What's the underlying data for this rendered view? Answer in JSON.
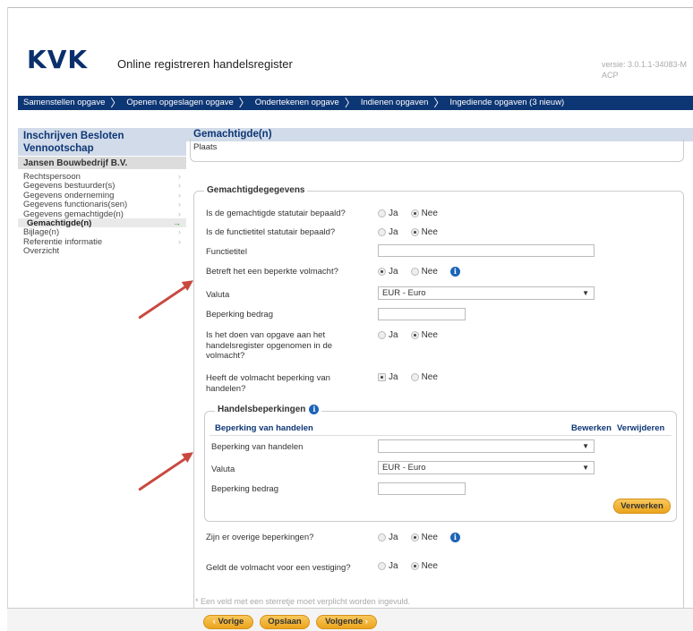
{
  "header": {
    "logo": "KVK",
    "title": "Online registreren handelsregister",
    "version": "versie: 3.0.1.1-34083-M",
    "version_env": "ACP"
  },
  "nav": {
    "steps": [
      "Samenstellen opgave",
      "Openen opgeslagen opgave",
      "Ondertekenen opgave",
      "Indienen opgaven",
      "Ingediende opgaven (3 nieuw)"
    ]
  },
  "sidebar": {
    "heading": "Inschrijven Besloten Vennootschap",
    "company": "Jansen Bouwbedrijf B.V.",
    "items": [
      {
        "label": "Rechtspersoon",
        "chevron": "›"
      },
      {
        "label": "Gegevens bestuurder(s)",
        "chevron": "›"
      },
      {
        "label": "Gegevens onderneming",
        "chevron": "›"
      },
      {
        "label": "Gegevens functionaris(sen)",
        "chevron": "›"
      },
      {
        "label": "Gegevens gemachtigde(n)",
        "chevron": "›"
      },
      {
        "label": "Gemachtigde(n)",
        "chevron": "→"
      },
      {
        "label": "Bijlage(n)",
        "chevron": "›"
      },
      {
        "label": "Referentie informatie",
        "chevron": "›"
      },
      {
        "label": "Overzicht",
        "chevron": ""
      }
    ]
  },
  "main": {
    "heading": "Gemachtigde(n)",
    "plaats_label": "Plaats",
    "fieldset_legend": "Gemachtigdegegevens",
    "radio_yes": "Ja",
    "radio_no": "Nee",
    "rows": {
      "statutair_gemachtigde": {
        "label": "Is de gemachtigde statutair bepaald?",
        "value": "Nee"
      },
      "statutair_functietitel": {
        "label": "Is de functietitel statutair bepaald?",
        "value": "Nee"
      },
      "functietitel": {
        "label": "Functietitel",
        "value": ""
      },
      "beperkte_volmacht": {
        "label": "Betreft het een beperkte volmacht?",
        "value": "Ja"
      },
      "valuta": {
        "label": "Valuta",
        "value": "EUR - Euro"
      },
      "beperking_bedrag": {
        "label": "Beperking bedrag",
        "value": ""
      },
      "opgave_handelsregister": {
        "label_line1": "Is het doen van opgave aan het",
        "label_line2": "handelsregister opgenomen in de",
        "label_line3": "volmacht?",
        "value": "Nee"
      },
      "beperking_handelen": {
        "label_line1": "Heeft de volmacht beperking van",
        "label_line2": "handelen?",
        "value": "Ja"
      }
    },
    "handelsbeperkingen": {
      "legend": "Handelsbeperkingen",
      "column_header": "Beperking van handelen",
      "edit_label": "Bewerken",
      "delete_label": "Verwijderen",
      "beperking_label": "Beperking van handelen",
      "beperking_value": "",
      "valuta_label": "Valuta",
      "valuta_value": "EUR - Euro",
      "bedrag_label": "Beperking bedrag",
      "process_button": "Verwerken"
    },
    "overige_beperkingen": {
      "label": "Zijn er overige beperkingen?",
      "value": "Nee"
    },
    "vestiging": {
      "label": "Geldt de volmacht voor een vestiging?",
      "value": "Nee"
    },
    "footnote": "* Een veld met een sterretje moet verplicht worden ingevuld."
  },
  "footer": {
    "prev": "Vorige",
    "save": "Opslaan",
    "next": "Volgende"
  },
  "colors": {
    "brand_navy": "#0d3675",
    "accent_orange": "#eba41d",
    "annotation_red": "#c8493f"
  }
}
